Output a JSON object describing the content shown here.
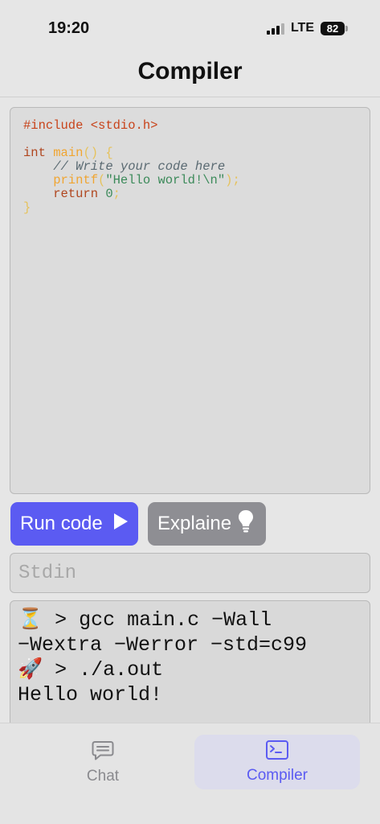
{
  "status_bar": {
    "time": "19:20",
    "network": "LTE",
    "battery": "82"
  },
  "nav": {
    "title": "Compiler"
  },
  "editor": {
    "lines": [
      "#include <stdio.h>",
      "",
      "int main() {",
      "    // Write your code here",
      "    printf(\"Hello world!\\n\");",
      "    return 0;",
      "}"
    ]
  },
  "actions": {
    "run_label": "Run code",
    "run_icon": "play-icon",
    "explain_label": "Explaine",
    "explain_icon": "lightbulb-icon"
  },
  "stdin": {
    "placeholder": "Stdin",
    "value": ""
  },
  "terminal": {
    "lines": [
      "⏳ > gcc main.c −Wall",
      "−Wextra −Werror −std=c99",
      "🚀 > ./a.out",
      "Hello world!"
    ]
  },
  "tabs": [
    {
      "label": "Chat",
      "icon": "chat-bubble-icon",
      "active": false
    },
    {
      "label": "Compiler",
      "icon": "terminal-icon",
      "active": true
    }
  ],
  "colors": {
    "accent": "#5b5bf2",
    "secondary_button": "#8e8e93",
    "preprocessor": "#c8431a",
    "function": "#f0a531",
    "string": "#3c8a5a",
    "comment": "#5a6a72"
  }
}
